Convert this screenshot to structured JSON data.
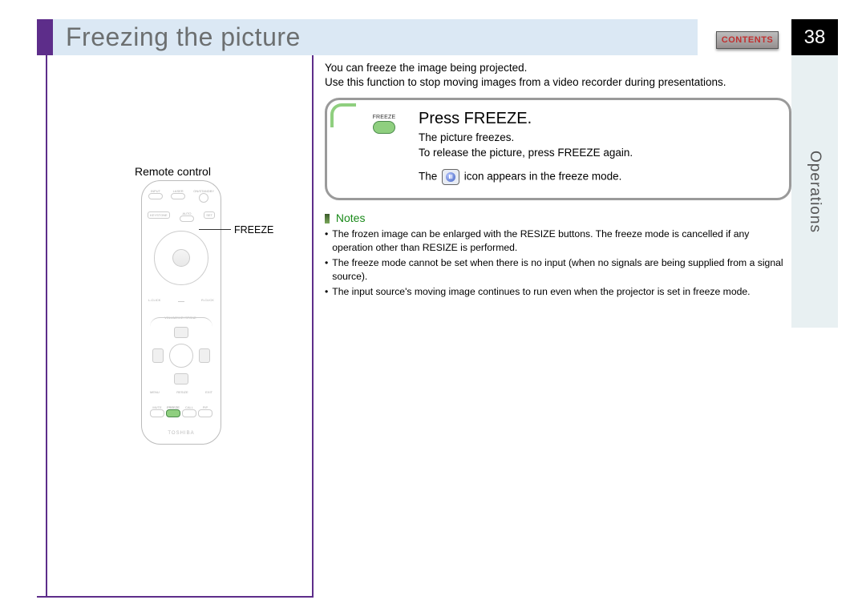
{
  "header": {
    "title": "Freezing the picture",
    "contents_label": "CONTENTS",
    "page_number": "38"
  },
  "side_tab": "Operations",
  "intro": {
    "line1": "You can freeze the image being projected.",
    "line2": "Use this function to stop moving images from a video recorder during presentations."
  },
  "panel": {
    "button_caption": "FREEZE",
    "title": "Press FREEZE.",
    "line1": "The picture freezes.",
    "line2": "To release the picture, press FREEZE again.",
    "line3_pre": "The ",
    "line3_post": " icon appears in the freeze mode."
  },
  "notes": {
    "heading": "Notes",
    "items": [
      "The frozen image can be enlarged with the RESIZE buttons. The freeze mode is cancelled if any operation other than RESIZE is performed.",
      "The freeze mode cannot be set when there is no input (when no signals are being supplied from a signal source).",
      "The input source's moving image continues to run even when the projector is set in freeze mode."
    ]
  },
  "remote": {
    "label": "Remote control",
    "callout": "FREEZE",
    "brand": "TOSHIBA",
    "btn_input": "INPUT",
    "btn_laser": "LASER",
    "btn_onstandby": "ON/STANDBY",
    "btn_keystone": "KEYSTONE",
    "btn_auto": "AUTO",
    "btn_set": "SET",
    "btn_lclick": "L-CLICK",
    "btn_rclick": "R-CLICK",
    "btn_volkey": "VOLUME/KEYSTONE",
    "btn_menu": "MENU",
    "btn_resize": "RESIZE",
    "btn_exit": "EXIT",
    "btn_mute": "MUTE",
    "btn_freeze": "FREEZE",
    "btn_call": "CALL",
    "btn_pip": "PIP"
  }
}
